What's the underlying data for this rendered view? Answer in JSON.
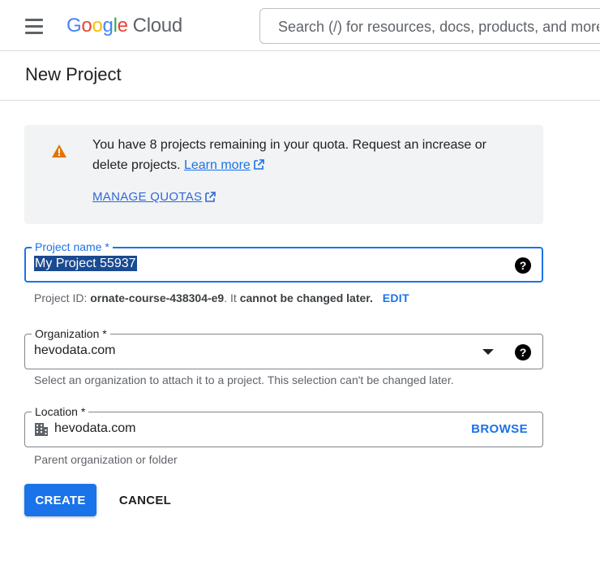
{
  "header": {
    "logo_google": "Google",
    "logo_cloud": "Cloud",
    "search_placeholder": "Search (/) for resources, docs, products, and more"
  },
  "page": {
    "title": "New Project"
  },
  "notice": {
    "text": "You have 8 projects remaining in your quota. Request an increase or delete projects.",
    "learn_more": "Learn more",
    "manage_quotas": "MANAGE QUOTAS",
    "icon": "warning-icon"
  },
  "project_name": {
    "label": "Project name *",
    "value": "My Project 55937"
  },
  "project_id": {
    "prefix": "Project ID:",
    "id": "ornate-course-438304-e9",
    "middle": ". It",
    "suffix": "cannot be changed later.",
    "edit_label": "EDIT"
  },
  "organization": {
    "label": "Organization *",
    "value": "hevodata.com",
    "hint": "Select an organization to attach it to a project. This selection can't be changed later."
  },
  "location": {
    "label": "Location *",
    "value": "hevodata.com",
    "browse_label": "BROWSE",
    "hint": "Parent organization or folder"
  },
  "actions": {
    "create_label": "CREATE",
    "cancel_label": "CANCEL"
  },
  "colors": {
    "accent": "#1a73e8",
    "warning": "#e37400",
    "notice_bg": "#f1f3f4"
  }
}
